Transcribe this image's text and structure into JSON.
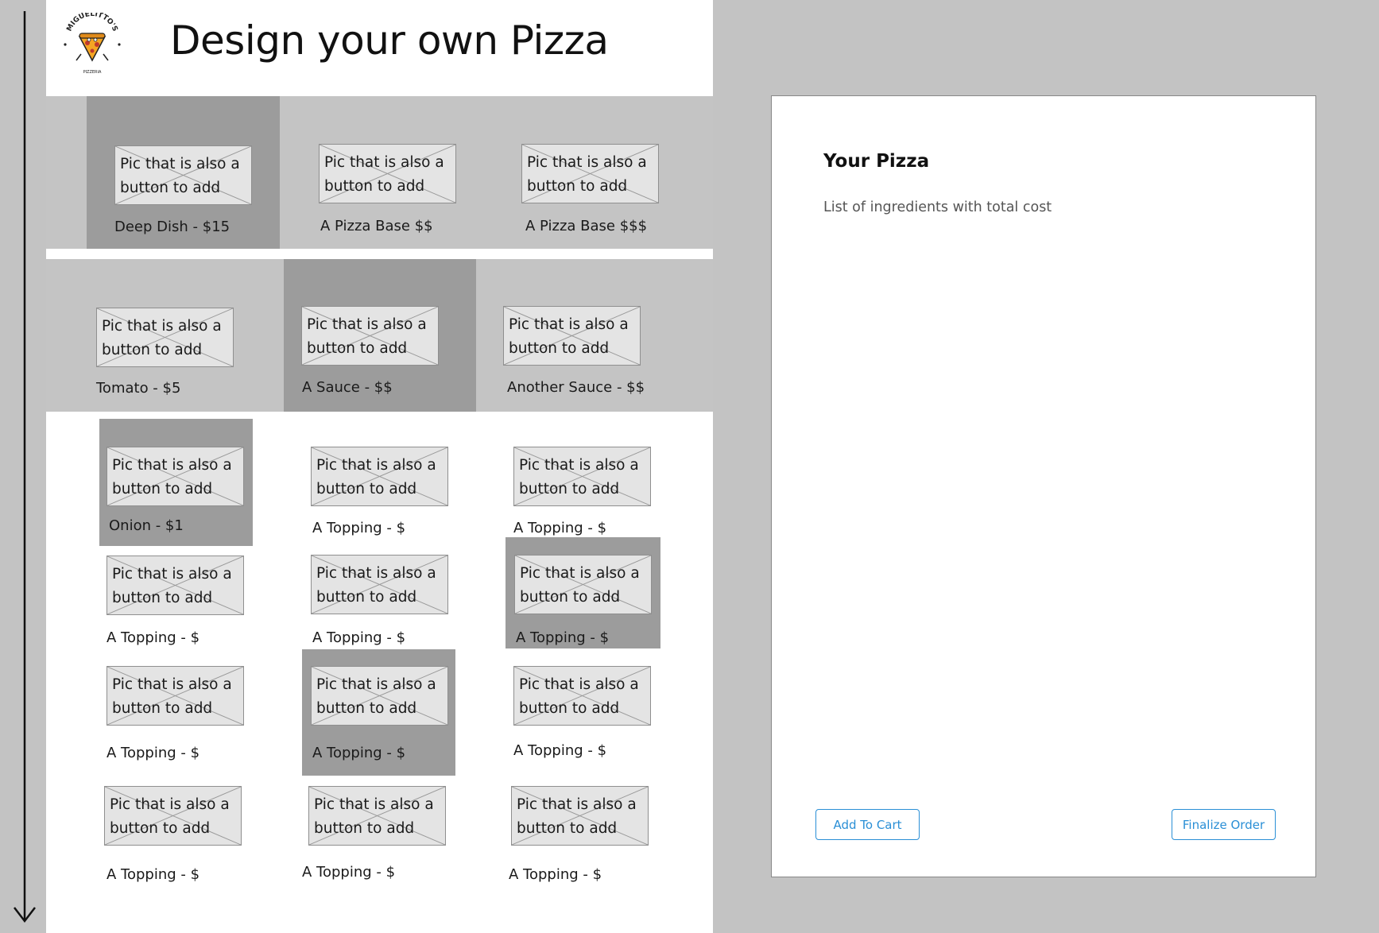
{
  "header": {
    "title": "Design your own Pizza",
    "logo": {
      "top_text": "MIGUELITTO'S",
      "bottom_text": "PIZZERIA"
    }
  },
  "pic_text": "Pic that is also a button to add",
  "bases": [
    {
      "label": "Deep Dish - $15",
      "selected": true
    },
    {
      "label": "A Pizza Base $$",
      "selected": false
    },
    {
      "label": "A Pizza Base $$$",
      "selected": false
    }
  ],
  "sauces": [
    {
      "label": "Tomato - $5",
      "selected": false
    },
    {
      "label": "A Sauce - $$",
      "selected": true
    },
    {
      "label": "Another Sauce - $$",
      "selected": false
    }
  ],
  "toppings": [
    {
      "label": "Onion - $1",
      "selected": true
    },
    {
      "label": "A Topping - $",
      "selected": false
    },
    {
      "label": "A Topping - $",
      "selected": false
    },
    {
      "label": "A Topping - $",
      "selected": false
    },
    {
      "label": "A Topping - $",
      "selected": false
    },
    {
      "label": "A Topping - $",
      "selected": true
    },
    {
      "label": "A Topping - $",
      "selected": false
    },
    {
      "label": "A Topping - $",
      "selected": true
    },
    {
      "label": "A Topping - $",
      "selected": false
    },
    {
      "label": "A Topping - $",
      "selected": false
    },
    {
      "label": "A Topping - $",
      "selected": false
    },
    {
      "label": "A Topping - $",
      "selected": false
    }
  ],
  "cart": {
    "title": "Your Pizza",
    "subtitle": "List of ingredients with total cost",
    "add_to_cart": "Add To Cart",
    "finalize": "Finalize Order"
  },
  "colors": {
    "background": "#c3c3c3",
    "band": "#c4c4c4",
    "selected": "#9c9c9c",
    "accent": "#2a8fd6"
  },
  "icons": {
    "scroll": "down-arrow-icon",
    "placeholder": "image-placeholder-icon"
  }
}
